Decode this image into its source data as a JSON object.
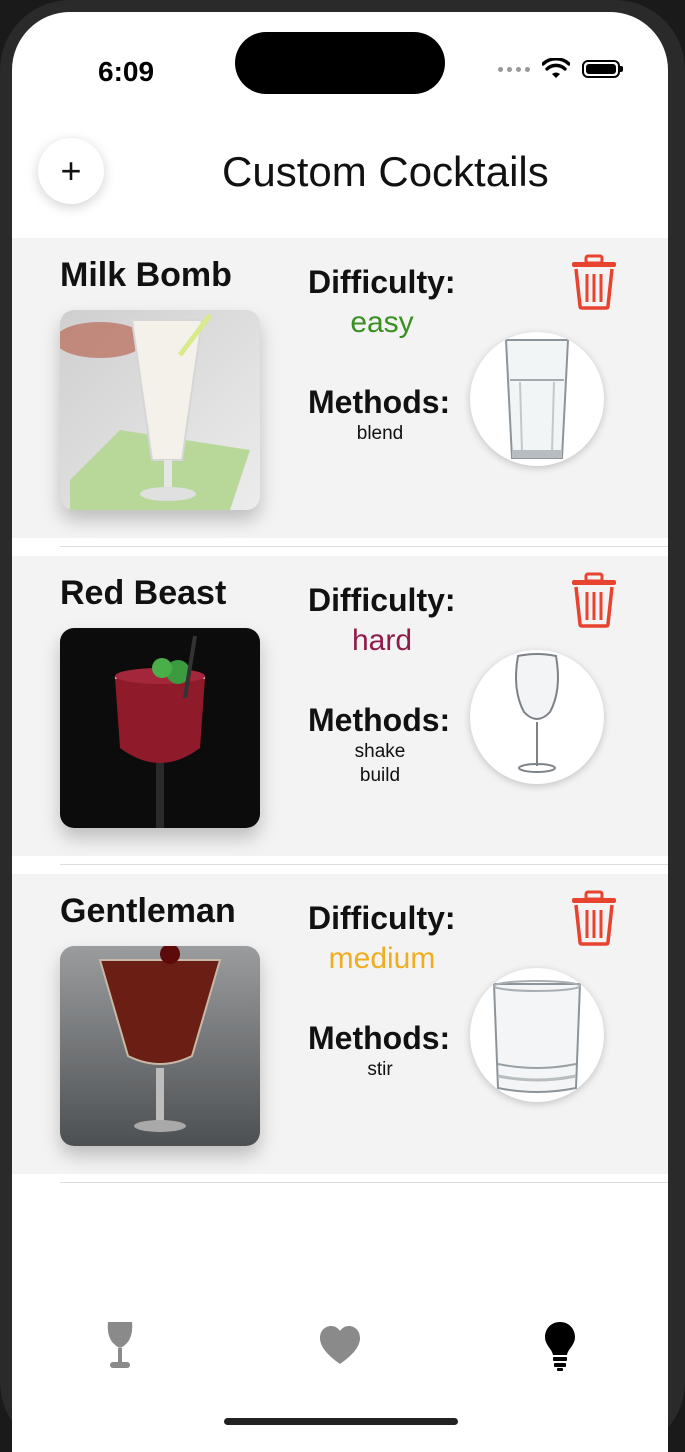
{
  "status": {
    "time": "6:09"
  },
  "header": {
    "title": "Custom Cocktails",
    "add_label": "+"
  },
  "cocktails": [
    {
      "name": "Milk Bomb",
      "difficulty_label": "Difficulty:",
      "difficulty": "easy",
      "difficulty_color": "#3a8f22",
      "methods_label": "Methods:",
      "methods": [
        "blend"
      ],
      "glass": "highball-glass",
      "photo": "milkshake-photo"
    },
    {
      "name": "Red Beast",
      "difficulty_label": "Difficulty:",
      "difficulty": "hard",
      "difficulty_color": "#8e1c4a",
      "methods_label": "Methods:",
      "methods": [
        "shake",
        "build"
      ],
      "glass": "wine-glass",
      "photo": "red-cocktail-photo"
    },
    {
      "name": "Gentleman",
      "difficulty_label": "Difficulty:",
      "difficulty": "medium",
      "difficulty_color": "#f0ad20",
      "methods_label": "Methods:",
      "methods": [
        "stir"
      ],
      "glass": "rocks-glass",
      "photo": "brown-cocktail-photo"
    }
  ],
  "tabbar": {
    "items": [
      {
        "icon": "wine-glass-icon",
        "active": false
      },
      {
        "icon": "heart-icon",
        "active": false
      },
      {
        "icon": "lightbulb-icon",
        "active": true
      }
    ],
    "inactive_color": "#8a8a8a",
    "active_color": "#000000"
  },
  "colors": {
    "delete": "#e8432f",
    "card_bg": "#f3f3f3"
  }
}
